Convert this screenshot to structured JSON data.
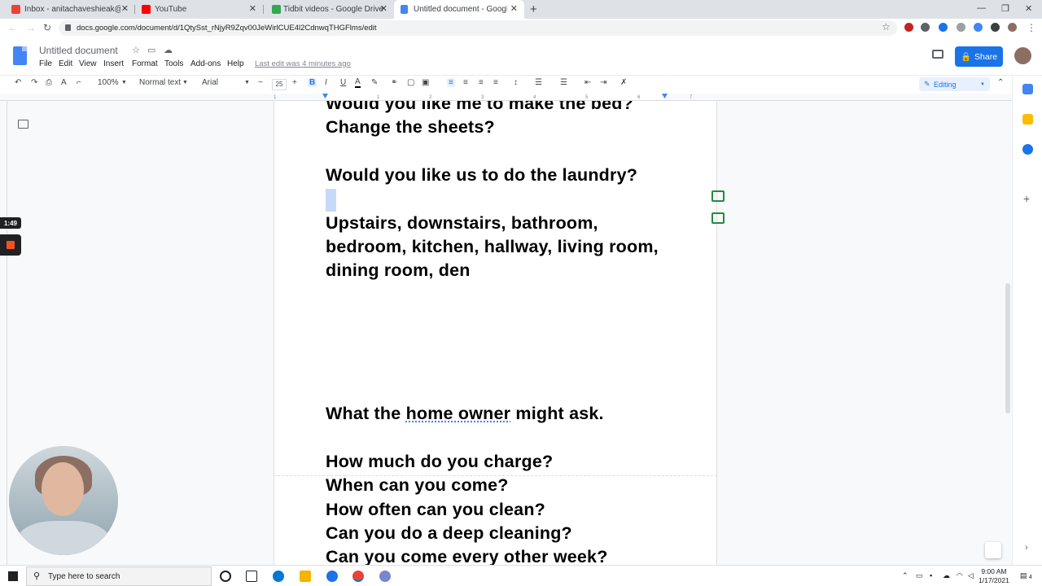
{
  "browser": {
    "tabs": [
      {
        "label": "Inbox - anitachaveshieak@gmail",
        "favicon_color": "#ea4335"
      },
      {
        "label": "YouTube",
        "favicon_color": "#ff0000"
      },
      {
        "label": "Tidbit videos - Google Drive",
        "favicon_color": "#34a853"
      },
      {
        "label": "Untitled document - Google Doc",
        "favicon_color": "#4285f4"
      }
    ],
    "url": "docs.google.com/document/d/1QtySst_rNjyR9Zqv00JeWirlCUE4l2CdnwqTHGFlms/edit"
  },
  "docs": {
    "title": "Untitled document",
    "menu": [
      "File",
      "Edit",
      "View",
      "Insert",
      "Format",
      "Tools",
      "Add-ons",
      "Help"
    ],
    "last_edit": "Last edit was 4 minutes ago",
    "share_label": "Share",
    "share_icon": "lock-icon",
    "toolbar": {
      "zoom": "100%",
      "style": "Normal text",
      "font": "Arial",
      "font_size": "25",
      "bold": "B",
      "italic": "I",
      "underline": "U",
      "mode": "Editing"
    },
    "lines": [
      "Would you like me to make the bed?",
      "Change the sheets?",
      "Would you like us to do the laundry?",
      "Upstairs, downstairs, bathroom,",
      "bedroom, kitchen, hallway, living room,",
      "dining room, den",
      "What the",
      "home owner",
      "might ask.",
      "How much do you charge?",
      "When can you come?",
      "How often can you clean?",
      "Can you do a deep cleaning?",
      "Can you come every other week?"
    ]
  },
  "recording": {
    "timer": "1:49",
    "stop_color": "#f4511e"
  },
  "taskbar": {
    "search_placeholder": "Type here to search",
    "time": "9:00 AM",
    "date": "1/17/2021",
    "notification_count": "4"
  },
  "colors": {
    "accent": "#1a73e8",
    "selection": "#c6d9f7"
  }
}
